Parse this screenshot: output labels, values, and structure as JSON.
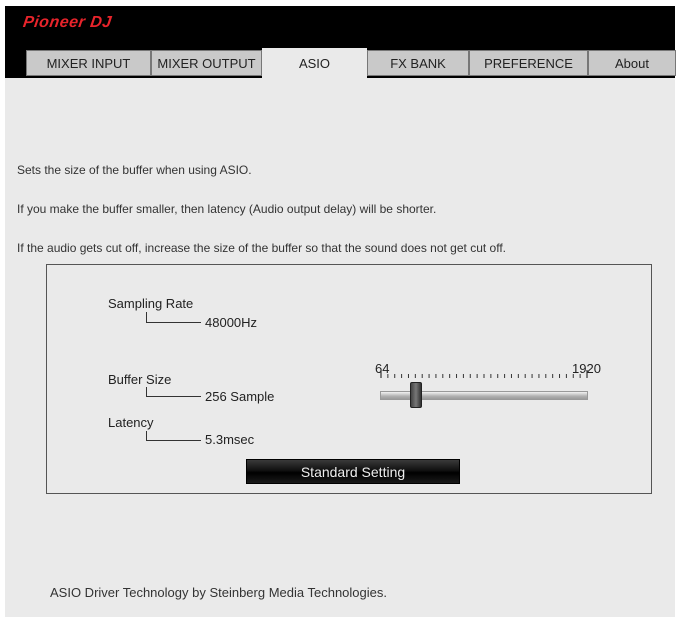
{
  "brand": {
    "logo": "Pioneer DJ",
    "logo_color": "#e8242b"
  },
  "tabs": [
    {
      "label": "MIXER INPUT"
    },
    {
      "label": "MIXER OUTPUT"
    },
    {
      "label": "ASIO"
    },
    {
      "label": "FX BANK"
    },
    {
      "label": "PREFERENCE"
    },
    {
      "label": "About"
    }
  ],
  "active_tab": "ASIO",
  "description": [
    "Sets the size of the buffer when using ASIO.",
    "If you make the buffer smaller, then latency (Audio output delay) will be shorter.",
    "If the audio gets cut off, increase the size of the buffer so that the sound does not get cut off."
  ],
  "panel": {
    "sampling_rate": {
      "label": "Sampling Rate",
      "value": "48000Hz"
    },
    "buffer_size": {
      "label": "Buffer Size",
      "value": "256 Sample"
    },
    "latency": {
      "label": "Latency",
      "value": "5.3msec"
    },
    "slider": {
      "min_label": "64",
      "max_label": "1920",
      "min": 64,
      "max": 1920,
      "value": 256,
      "tick_count": 30
    },
    "standard_button": "Standard Setting"
  },
  "footer": "ASIO Driver Technology by Steinberg Media Technologies."
}
